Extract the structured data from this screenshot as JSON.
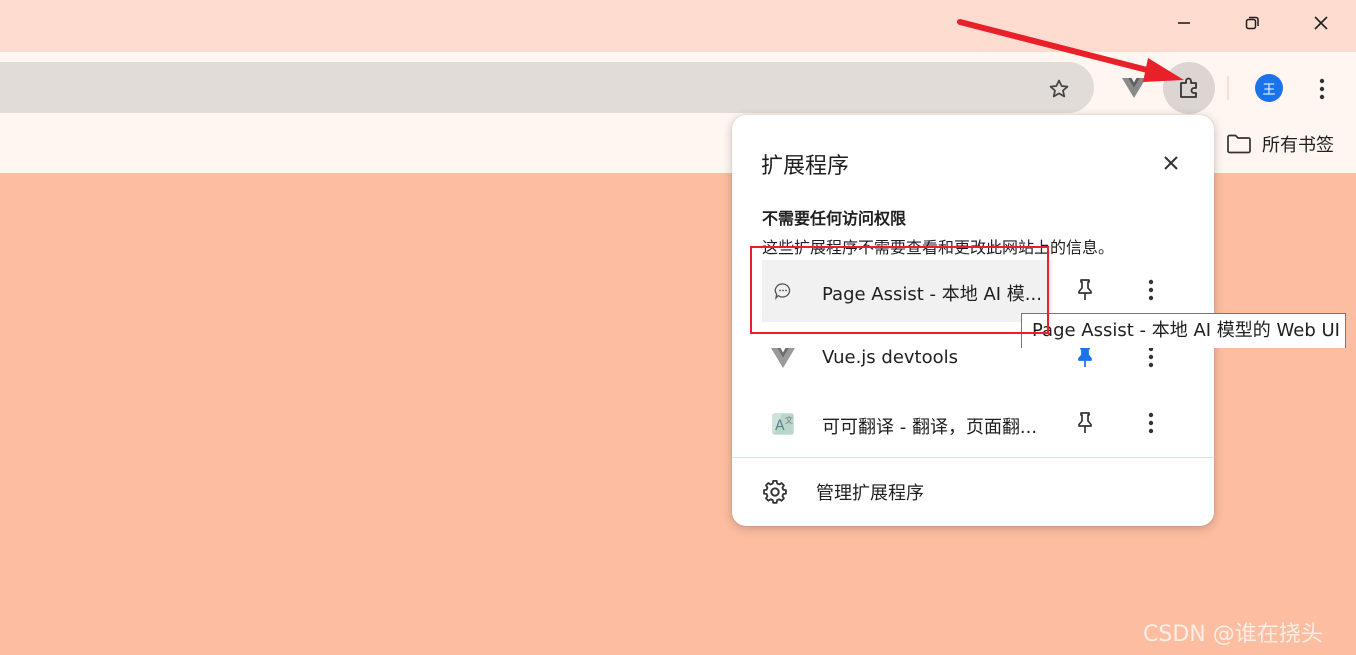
{
  "window": {
    "minimize_icon": "minimize-icon",
    "restore_icon": "restore-icon",
    "close_icon": "close-icon"
  },
  "toolbar": {
    "star_icon": "star-icon",
    "vue_icon": "vue-icon",
    "extensions_icon": "puzzle-icon",
    "avatar_text": "王",
    "avatar_color": "#1a73e8",
    "menu_icon": "kebab-menu-icon"
  },
  "bookmarks": {
    "all_label": "所有书签",
    "folder_icon": "folder-icon"
  },
  "extensions_popup": {
    "title": "扩展程序",
    "section_heading": "不需要任何访问权限",
    "section_desc": "这些扩展程序不需要查看和更改此网站上的信息。",
    "items": [
      {
        "name": "Page Assist - 本地 AI 模...",
        "icon": "chat-bubble-icon",
        "pinned": false
      },
      {
        "name": "Vue.js devtools",
        "icon": "vue-icon",
        "pinned": true
      },
      {
        "name": "可可翻译 - 翻译，页面翻...",
        "icon": "translate-icon",
        "pinned": false
      }
    ],
    "manage_label": "管理扩展程序",
    "pin_color_active": "#1a73e8"
  },
  "tooltip": {
    "text": "Page Assist - 本地 AI 模型的 Web UI"
  },
  "annotation": {
    "color": "#e8202a"
  },
  "watermark": {
    "text": "CSDN @谁在挠头"
  }
}
